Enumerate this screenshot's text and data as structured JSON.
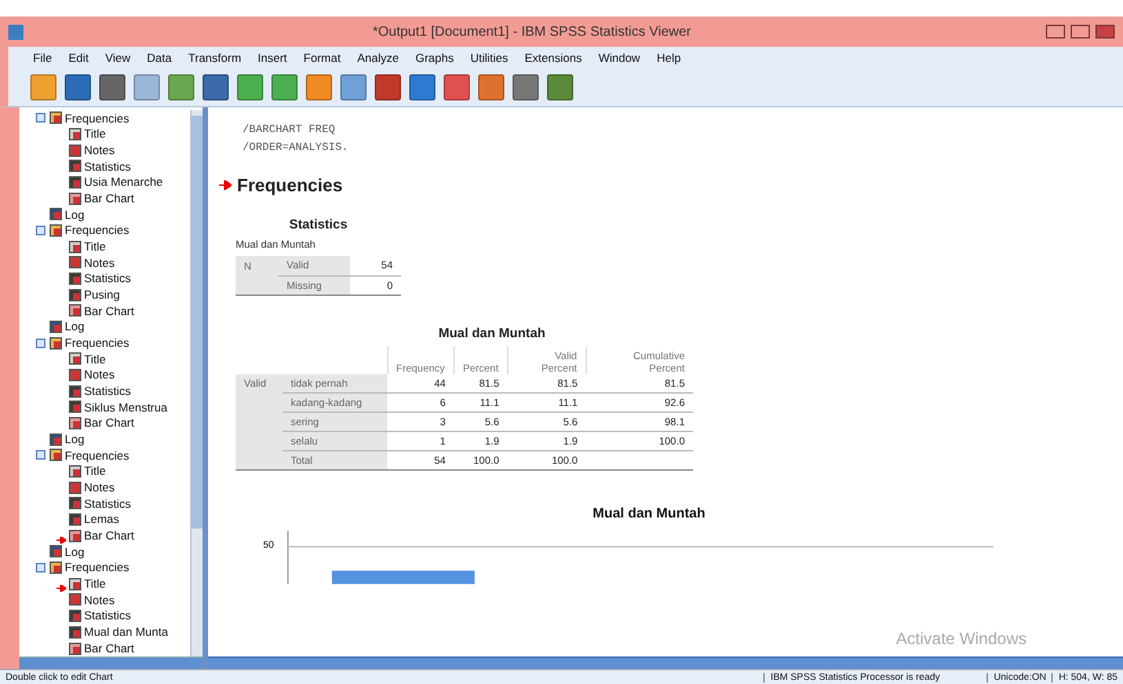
{
  "window": {
    "title": "*Output1 [Document1] - IBM SPSS Statistics Viewer"
  },
  "menu": [
    "File",
    "Edit",
    "View",
    "Data",
    "Transform",
    "Insert",
    "Format",
    "Analyze",
    "Graphs",
    "Utilities",
    "Extensions",
    "Window",
    "Help"
  ],
  "outline": [
    {
      "label": "Frequencies",
      "kind": "frequencies",
      "expanded": true,
      "marked": false,
      "children": [
        {
          "label": "Title",
          "kind": "title",
          "marked": false
        },
        {
          "label": "Notes",
          "kind": "notes",
          "marked": false
        },
        {
          "label": "Statistics",
          "kind": "table",
          "marked": false
        },
        {
          "label": "Usia Menarche",
          "kind": "table",
          "marked": false
        },
        {
          "label": "Bar Chart",
          "kind": "chart",
          "marked": false
        }
      ]
    },
    {
      "label": "Log",
      "kind": "log",
      "marked": false
    },
    {
      "label": "Frequencies",
      "kind": "frequencies",
      "expanded": true,
      "marked": false,
      "children": [
        {
          "label": "Title",
          "kind": "title",
          "marked": false
        },
        {
          "label": "Notes",
          "kind": "notes",
          "marked": false
        },
        {
          "label": "Statistics",
          "kind": "table",
          "marked": false
        },
        {
          "label": "Pusing",
          "kind": "table",
          "marked": false
        },
        {
          "label": "Bar Chart",
          "kind": "chart",
          "marked": false
        }
      ]
    },
    {
      "label": "Log",
      "kind": "log",
      "marked": false
    },
    {
      "label": "Frequencies",
      "kind": "frequencies",
      "expanded": true,
      "marked": false,
      "children": [
        {
          "label": "Title",
          "kind": "title",
          "marked": false
        },
        {
          "label": "Notes",
          "kind": "notes",
          "marked": false
        },
        {
          "label": "Statistics",
          "kind": "table",
          "marked": false
        },
        {
          "label": "Siklus Menstrua",
          "kind": "table",
          "marked": false
        },
        {
          "label": "Bar Chart",
          "kind": "chart",
          "marked": false
        }
      ]
    },
    {
      "label": "Log",
      "kind": "log",
      "marked": false
    },
    {
      "label": "Frequencies",
      "kind": "frequencies",
      "expanded": true,
      "marked": false,
      "children": [
        {
          "label": "Title",
          "kind": "title",
          "marked": false
        },
        {
          "label": "Notes",
          "kind": "notes",
          "marked": false
        },
        {
          "label": "Statistics",
          "kind": "table",
          "marked": false
        },
        {
          "label": "Lemas",
          "kind": "table",
          "marked": false
        },
        {
          "label": "Bar Chart",
          "kind": "chart",
          "marked": true
        }
      ]
    },
    {
      "label": "Log",
      "kind": "log",
      "marked": false
    },
    {
      "label": "Frequencies",
      "kind": "frequencies",
      "expanded": true,
      "marked": false,
      "children": [
        {
          "label": "Title",
          "kind": "title",
          "marked": true
        },
        {
          "label": "Notes",
          "kind": "notes",
          "marked": false
        },
        {
          "label": "Statistics",
          "kind": "table",
          "marked": false
        },
        {
          "label": "Mual dan Munta",
          "kind": "table",
          "marked": false
        },
        {
          "label": "Bar Chart",
          "kind": "chart",
          "marked": false
        }
      ]
    }
  ],
  "syntax": [
    "/BARCHART FREQ",
    "/ORDER=ANALYSIS."
  ],
  "heading": "Frequencies",
  "statistics": {
    "title": "Statistics",
    "variable": "Mual dan Muntah",
    "rows": [
      [
        "N",
        "Valid",
        "54"
      ],
      [
        "",
        "Missing",
        "0"
      ]
    ]
  },
  "frequency_table": {
    "title": "Mual dan Muntah",
    "columns": [
      "Frequency",
      "Percent",
      "Valid Percent",
      "Cumulative Percent"
    ],
    "rows": [
      {
        "group": "Valid",
        "label": "tidak pernah",
        "cells": [
          "44",
          "81.5",
          "81.5",
          "81.5"
        ]
      },
      {
        "group": "",
        "label": "kadang-kadang",
        "cells": [
          "6",
          "11.1",
          "11.1",
          "92.6"
        ]
      },
      {
        "group": "",
        "label": "sering",
        "cells": [
          "3",
          "5.6",
          "5.6",
          "98.1"
        ]
      },
      {
        "group": "",
        "label": "selalu",
        "cells": [
          "1",
          "1.9",
          "1.9",
          "100.0"
        ]
      },
      {
        "group": "",
        "label": "Total",
        "cells": [
          "54",
          "100.0",
          "100.0",
          ""
        ]
      }
    ]
  },
  "chart": {
    "title": "Mual dan Muntah",
    "tick_label": "50"
  },
  "activation_notice": "Activate Windows",
  "status_bar": {
    "hint": "Double click to edit Chart",
    "processor": "IBM SPSS Statistics Processor is ready",
    "unicode": "Unicode:ON",
    "size": "H: 504, W: 85"
  }
}
